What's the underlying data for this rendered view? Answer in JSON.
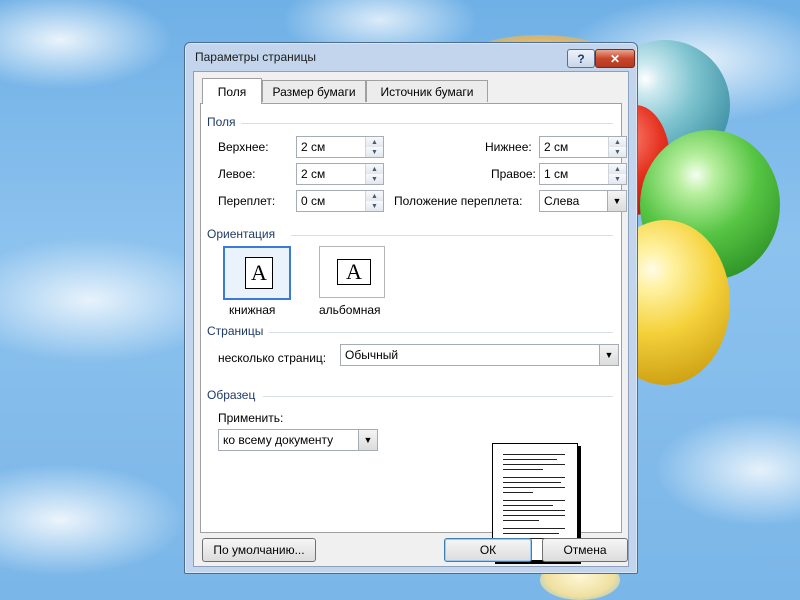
{
  "dialog": {
    "title": "Параметры страницы",
    "help_label": "?",
    "close_label": "✕"
  },
  "tabs": [
    {
      "label": "Поля",
      "active": true
    },
    {
      "label": "Размер бумаги",
      "active": false
    },
    {
      "label": "Источник бумаги",
      "active": false
    }
  ],
  "margins": {
    "group_label": "Поля",
    "top_label": "Верхнее:",
    "top_value": "2 см",
    "left_label": "Левое:",
    "left_value": "2 см",
    "gutter_label": "Переплет:",
    "gutter_value": "0 см",
    "bottom_label": "Нижнее:",
    "bottom_value": "2 см",
    "right_label": "Правое:",
    "right_value": "1 см",
    "gutter_pos_label": "Положение переплета:",
    "gutter_pos_value": "Слева"
  },
  "orientation": {
    "group_label": "Ориентация",
    "portrait_label": "книжная",
    "landscape_label": "альбомная",
    "selected": "portrait",
    "icon_letter": "A"
  },
  "pages": {
    "group_label": "Страницы",
    "multiple_label": "несколько страниц:",
    "multiple_value": "Обычный"
  },
  "sample": {
    "group_label": "Образец",
    "apply_label": "Применить:",
    "apply_value": "ко всему документу"
  },
  "buttons": {
    "default_label": "По умолчанию...",
    "ok_label": "ОК",
    "cancel_label": "Отмена"
  },
  "icons": {
    "spin_up": "▲",
    "spin_down": "▼",
    "dropdown": "▼"
  }
}
